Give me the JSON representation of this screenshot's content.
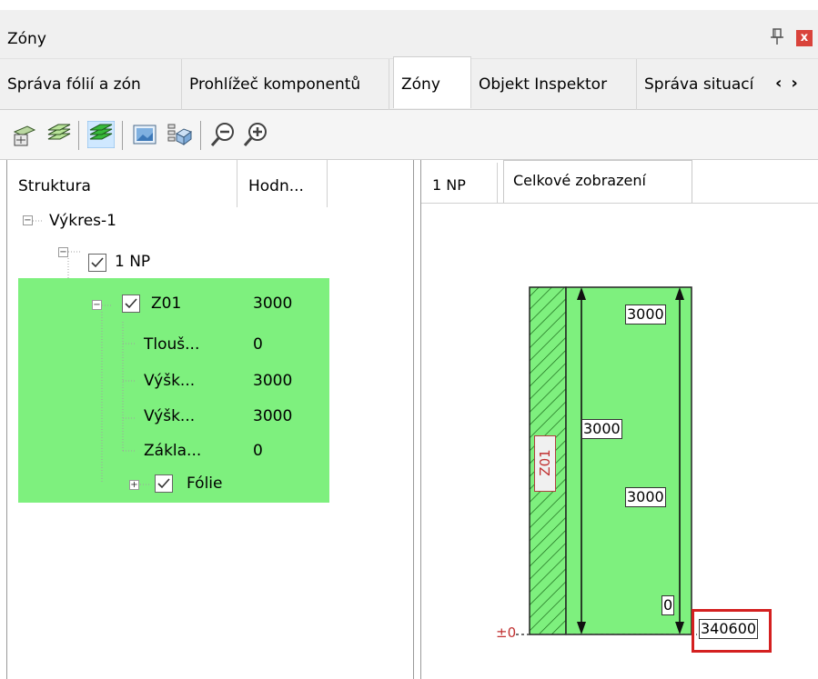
{
  "window": {
    "title": "Zóny"
  },
  "tabs": [
    {
      "label": "Správa fólií a zón",
      "active": false
    },
    {
      "label": "Prohlížeč komponentů",
      "active": false
    },
    {
      "label": "Zóny",
      "active": true
    },
    {
      "label": "Objekt Inspektor",
      "active": false
    },
    {
      "label": "Správa situací",
      "active": false
    }
  ],
  "toolbar": {
    "icons": [
      "add-layer-icon",
      "layers-icon",
      "active-layers-icon",
      "image-icon",
      "components-icon",
      "zoom-out-icon",
      "zoom-in-icon"
    ]
  },
  "tree": {
    "columns": {
      "structure": "Struktura",
      "value": "Hodn..."
    },
    "root": {
      "label": "Výkres-1"
    },
    "floor": {
      "label": "1 NP",
      "checked": true
    },
    "zone": {
      "label": "Z01",
      "value": "3000",
      "checked": true
    },
    "props": [
      {
        "label": "Tlouš...",
        "value": "0"
      },
      {
        "label": "Výšk...",
        "value": "3000"
      },
      {
        "label": "Výšk...",
        "value": "3000"
      },
      {
        "label": "Zákla...",
        "value": "0"
      }
    ],
    "folie": {
      "label": "Fólie",
      "checked": true
    },
    "highlight_color": "#7ef07e"
  },
  "preview": {
    "tabs": [
      {
        "label": "1 NP",
        "active": false
      },
      {
        "label": "Celkové zobrazení",
        "active": true
      }
    ],
    "zone_label": "Z01",
    "dims": {
      "top_right": "3000",
      "left_mid": "3000",
      "right_mid": "3000",
      "bottom_right": "0",
      "base": "340600"
    },
    "level_label": "±0",
    "highlight_color": "#d42020"
  }
}
